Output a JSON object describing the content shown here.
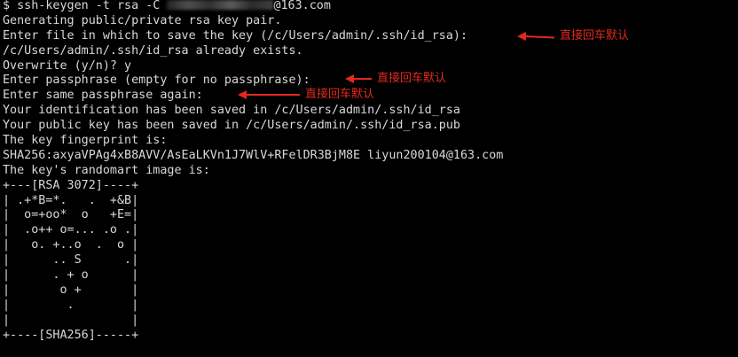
{
  "terminal": {
    "command": {
      "prefix": "$ ssh-keygen -t rsa -C ",
      "email_suffix": "@163.com"
    },
    "lines": [
      "Generating public/private rsa key pair.",
      "Enter file in which to save the key (/c/Users/admin/.ssh/id_rsa):",
      "/c/Users/admin/.ssh/id_rsa already exists.",
      "Overwrite (y/n)? y",
      "Enter passphrase (empty for no passphrase):",
      "Enter same passphrase again:",
      "Your identification has been saved in /c/Users/admin/.ssh/id_rsa",
      "Your public key has been saved in /c/Users/admin/.ssh/id_rsa.pub",
      "The key fingerprint is:",
      "SHA256:axyaVPAg4xB8AVV/AsEaLKVn1J7WlV+RFelDR3BjM8E liyun200104@163.com",
      "The key's randomart image is:",
      "+---[RSA 3072]----+",
      "| .+*B=*.   .  +&B|",
      "|  o=+oo*  o   +E=|",
      "|  .o++ o=... .o .|",
      "|   o. +..o  .  o |",
      "|      .. S      .|",
      "|      . + o      |",
      "|       o +       |",
      "|        .        |",
      "|                 |",
      "+----[SHA256]-----+"
    ]
  },
  "annotations": {
    "save_file": "直接回车默认",
    "passphrase": "直接回车默认",
    "passphrase_again": "直接回车默认",
    "color": "#e4291c"
  }
}
